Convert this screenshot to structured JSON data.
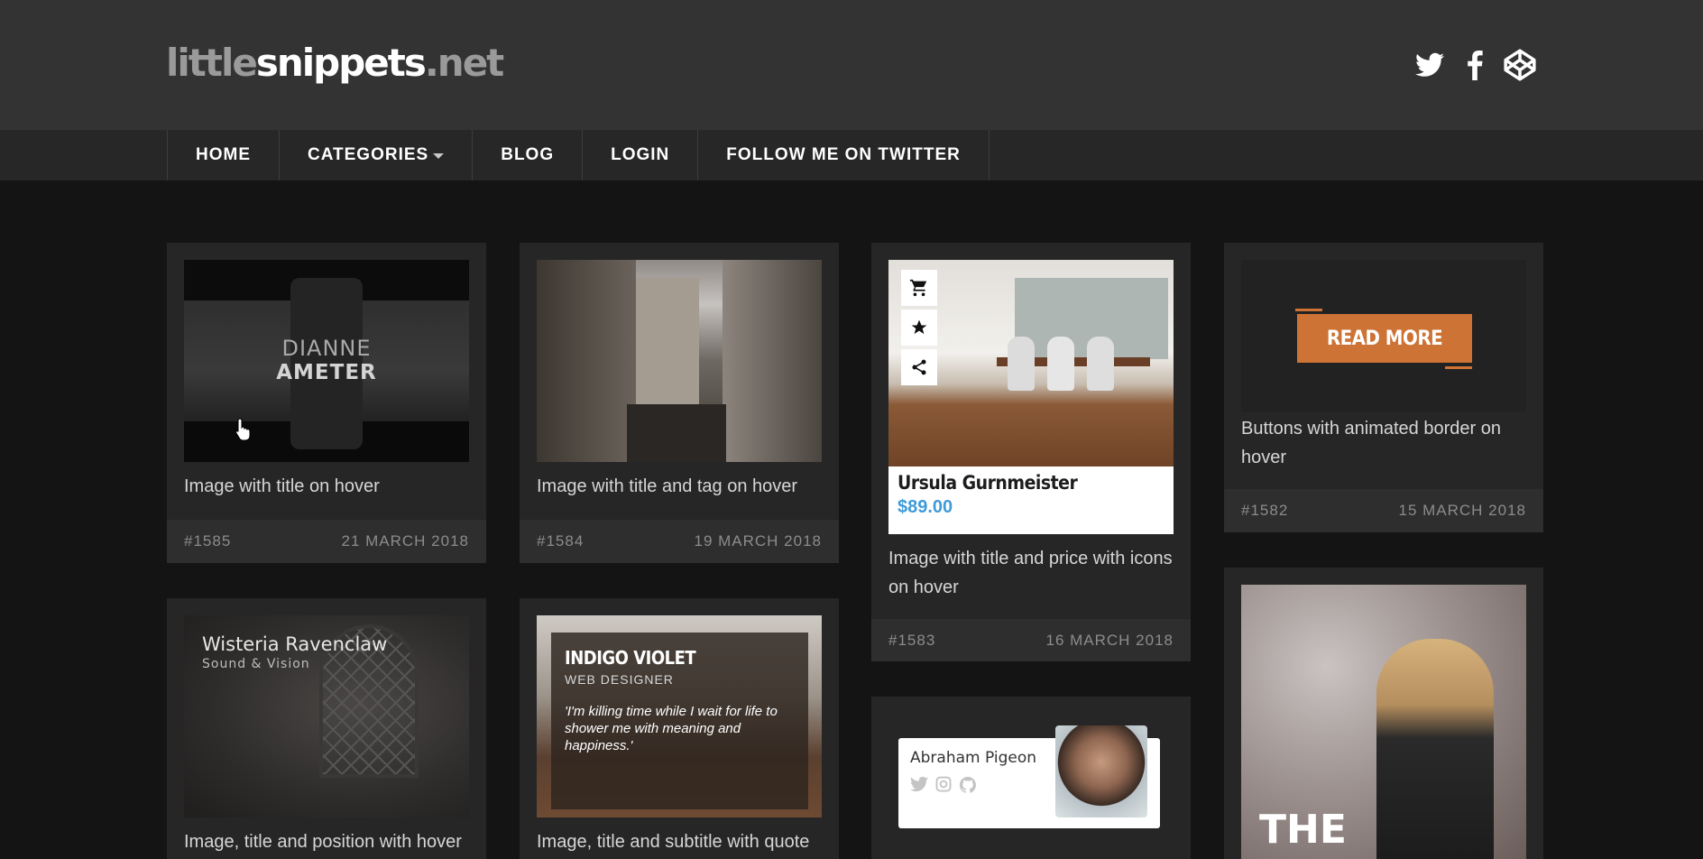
{
  "site": {
    "logo_part1": "little",
    "logo_part2": "snippets",
    "logo_part3": ".net"
  },
  "social": [
    {
      "icon": "twitter-icon"
    },
    {
      "icon": "facebook-icon"
    },
    {
      "icon": "codepen-icon"
    }
  ],
  "nav": {
    "home": "HOME",
    "categories": "CATEGORIES",
    "blog": "BLOG",
    "login": "LOGIN",
    "twitter": "FOLLOW ME ON TWITTER"
  },
  "cards": {
    "c1585": {
      "overlay_first": "DIANNE",
      "overlay_last": "AMETER",
      "title": "Image with title on hover",
      "id": "#1585",
      "date": "21 MARCH 2018"
    },
    "c1584": {
      "title": "Image with title and tag on hover",
      "id": "#1584",
      "date": "19 MARCH 2018"
    },
    "c1583": {
      "name": "Ursula Gurnmeister",
      "price": "$89.00",
      "title": "Image with title and price with icons on hover",
      "id": "#1583",
      "date": "16 MARCH 2018"
    },
    "c1582": {
      "button": "READ MORE",
      "title": "Buttons with animated border on hover",
      "id": "#1582",
      "date": "15 MARCH 2018"
    },
    "wisteria": {
      "name": "Wisteria Ravenclaw",
      "position": "Sound & Vision",
      "title": "Image, title and position with hover"
    },
    "indigo": {
      "name": "INDIGO VIOLET",
      "role": "WEB DESIGNER",
      "quote": "'I'm killing time while I wait for life to shower me with meaning and happiness.'",
      "title": "Image, title and subtitle with quote"
    },
    "abraham": {
      "name": "Abraham Pigeon"
    },
    "the": {
      "text": "THE"
    }
  },
  "colors": {
    "accent_orange": "#cd7335",
    "price_blue": "#3f9bd8",
    "header_bg": "#333333",
    "nav_bg": "#272727",
    "page_bg": "#141414",
    "card_bg": "#262626"
  }
}
